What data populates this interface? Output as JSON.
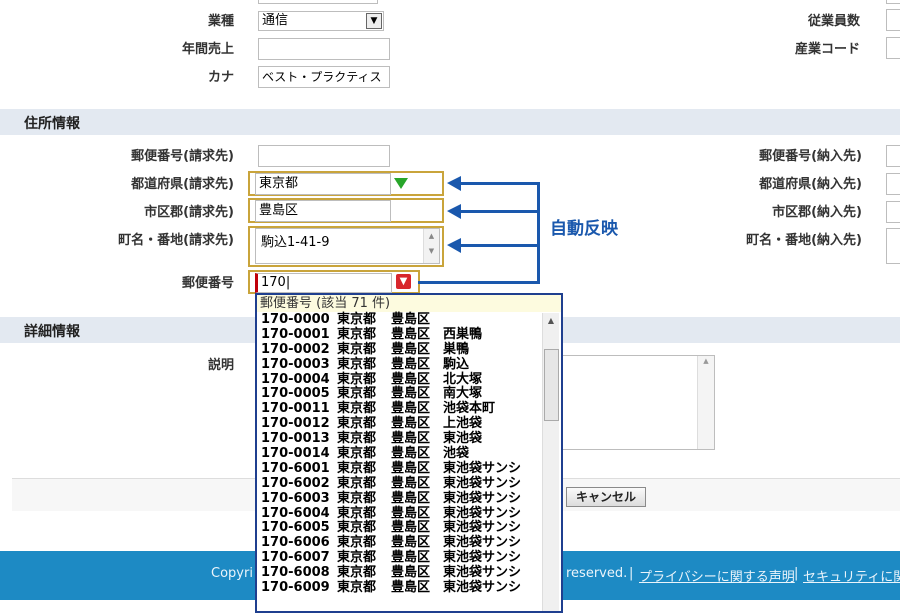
{
  "company": {
    "industry_label": "業種",
    "industry_value": "通信",
    "annual_sales_label": "年間売上",
    "kana_label": "カナ",
    "kana_value": "ベスト・プラクティス",
    "employees_label": "従業員数",
    "industry_code_label": "産業コード"
  },
  "address_section": {
    "title": "住所情報",
    "billing_zip_label": "郵便番号(請求先)",
    "billing_pref_label": "都道府県(請求先)",
    "billing_pref_value": "東京都",
    "billing_city_label": "市区郡(請求先)",
    "billing_city_value": "豊島区",
    "billing_street_label": "町名・番地(請求先)",
    "billing_street_value": "駒込1-41-9",
    "zip_label": "郵便番号",
    "zip_value": "170|",
    "shipping_zip_label": "郵便番号(納入先)",
    "shipping_pref_label": "都道府県(納入先)",
    "shipping_city_label": "市区郡(納入先)",
    "shipping_street_label": "町名・番地(納入先)"
  },
  "annotation": {
    "text": "自動反映"
  },
  "detail_section": {
    "title": "詳細情報",
    "description_label": "説明"
  },
  "buttons": {
    "cancel_label": "キャンセル"
  },
  "popup": {
    "header": "郵便番号 (該当 71 件)",
    "rows": [
      {
        "code": "170-0000",
        "pref": "東京都",
        "ward": "豊島区",
        "town": ""
      },
      {
        "code": "170-0001",
        "pref": "東京都",
        "ward": "豊島区",
        "town": "西巣鴨"
      },
      {
        "code": "170-0002",
        "pref": "東京都",
        "ward": "豊島区",
        "town": "巣鴨"
      },
      {
        "code": "170-0003",
        "pref": "東京都",
        "ward": "豊島区",
        "town": "駒込"
      },
      {
        "code": "170-0004",
        "pref": "東京都",
        "ward": "豊島区",
        "town": "北大塚"
      },
      {
        "code": "170-0005",
        "pref": "東京都",
        "ward": "豊島区",
        "town": "南大塚"
      },
      {
        "code": "170-0011",
        "pref": "東京都",
        "ward": "豊島区",
        "town": "池袋本町"
      },
      {
        "code": "170-0012",
        "pref": "東京都",
        "ward": "豊島区",
        "town": "上池袋"
      },
      {
        "code": "170-0013",
        "pref": "東京都",
        "ward": "豊島区",
        "town": "東池袋"
      },
      {
        "code": "170-0014",
        "pref": "東京都",
        "ward": "豊島区",
        "town": "池袋"
      },
      {
        "code": "170-6001",
        "pref": "東京都",
        "ward": "豊島区",
        "town": "東池袋サンシ"
      },
      {
        "code": "170-6002",
        "pref": "東京都",
        "ward": "豊島区",
        "town": "東池袋サンシ"
      },
      {
        "code": "170-6003",
        "pref": "東京都",
        "ward": "豊島区",
        "town": "東池袋サンシ"
      },
      {
        "code": "170-6004",
        "pref": "東京都",
        "ward": "豊島区",
        "town": "東池袋サンシ"
      },
      {
        "code": "170-6005",
        "pref": "東京都",
        "ward": "豊島区",
        "town": "東池袋サンシ"
      },
      {
        "code": "170-6006",
        "pref": "東京都",
        "ward": "豊島区",
        "town": "東池袋サンシ"
      },
      {
        "code": "170-6007",
        "pref": "東京都",
        "ward": "豊島区",
        "town": "東池袋サンシ"
      },
      {
        "code": "170-6008",
        "pref": "東京都",
        "ward": "豊島区",
        "town": "東池袋サンシ"
      },
      {
        "code": "170-6009",
        "pref": "東京都",
        "ward": "豊島区",
        "town": "東池袋サンシ"
      }
    ]
  },
  "footer": {
    "copyright_fragment": "Copyri",
    "reserved_text": "reserved.",
    "privacy_link": "プライバシーに関する声明",
    "security_link": "セキュリティに関す"
  },
  "colors": {
    "accent": "#1a58ad",
    "highlight": "#c9a43b",
    "section_bg": "#e3e9f1",
    "footer_bg": "#1d8ac4"
  }
}
